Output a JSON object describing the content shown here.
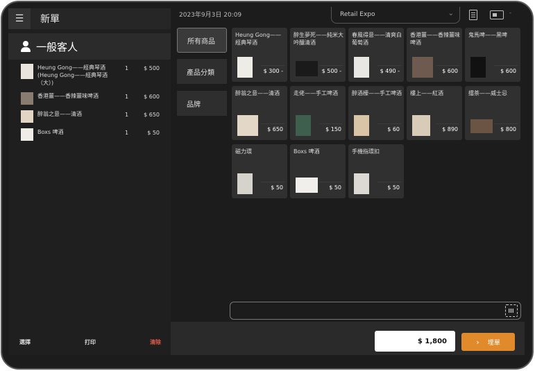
{
  "header": {
    "order_title": "新單",
    "datetime": "2023年9月3日 20:09",
    "store": "Retail Expo"
  },
  "customer": {
    "name": "一般客人"
  },
  "cart": [
    {
      "name": "Heung Gong——經典琴酒 (Heung Gong——經典琴酒（大）)",
      "qty": "1",
      "price": "$ 500"
    },
    {
      "name": "香港薑——香辣薑味啤酒",
      "qty": "1",
      "price": "$ 600"
    },
    {
      "name": "醉翁之意——清酒",
      "qty": "1",
      "price": "$ 650"
    },
    {
      "name": "Boxs 啤酒",
      "qty": "1",
      "price": "$ 50"
    }
  ],
  "footer": {
    "select": "選擇",
    "print": "打印",
    "clear": "清除"
  },
  "categories": [
    "所有商品",
    "產品分類",
    "品牌"
  ],
  "products": [
    {
      "name": "Heung Gong——經典琴酒",
      "price": "$ 300 -"
    },
    {
      "name": "醉生夢死——純米大吟釀清酒",
      "price": "$ 500 -"
    },
    {
      "name": "春風得意——清爽白葡萄酒",
      "price": "$ 490 -"
    },
    {
      "name": "香港薑——香辣薑味啤酒",
      "price": "$ 600"
    },
    {
      "name": "鬼馬啤——黑啤",
      "price": "$ 600"
    },
    {
      "name": "醉翁之意——清酒",
      "price": "$ 650"
    },
    {
      "name": "走佬——手工啤酒",
      "price": "$ 150"
    },
    {
      "name": "醉酒檬——手工啤酒",
      "price": "$ 60"
    },
    {
      "name": "樓上——紅酒",
      "price": "$ 890"
    },
    {
      "name": "擂茶——威士忌",
      "price": "$ 800"
    },
    {
      "name": "磁力環",
      "price": "$ 50"
    },
    {
      "name": "Boxs 啤酒",
      "price": "$ 50"
    },
    {
      "name": "手機指環扣",
      "price": "$ 50"
    }
  ],
  "total": "$ 1,800",
  "checkout_label": "埋單",
  "colors": {
    "accent": "#e08a2c",
    "clear": "#e05a4a"
  }
}
